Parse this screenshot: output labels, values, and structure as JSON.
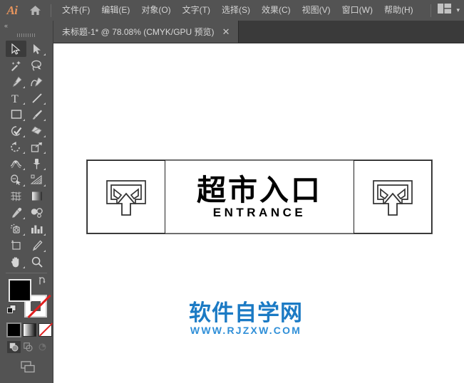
{
  "app": {
    "name": "Ai",
    "logo_color": "#e8955d"
  },
  "menubar": {
    "home_icon": "home-icon",
    "items": [
      {
        "label": "文件(F)",
        "name": "menu-file"
      },
      {
        "label": "编辑(E)",
        "name": "menu-edit"
      },
      {
        "label": "对象(O)",
        "name": "menu-object"
      },
      {
        "label": "文字(T)",
        "name": "menu-type"
      },
      {
        "label": "选择(S)",
        "name": "menu-select"
      },
      {
        "label": "效果(C)",
        "name": "menu-effect"
      },
      {
        "label": "视图(V)",
        "name": "menu-view"
      },
      {
        "label": "窗口(W)",
        "name": "menu-window"
      },
      {
        "label": "帮助(H)",
        "name": "menu-help"
      }
    ],
    "workspace_icon": "workspace-switcher-icon",
    "workspace_chevron": "▾"
  },
  "tabbar": {
    "document_title": "未标题-1* @ 78.08% (CMYK/GPU 预览)",
    "close_label": "✕"
  },
  "toolbar": {
    "collapse_label": "«",
    "tools": [
      {
        "name": "selection-tool",
        "label": "选择工具",
        "active": true,
        "corner": false
      },
      {
        "name": "direct-selection-tool",
        "label": "直接选择工具",
        "active": false,
        "corner": true
      },
      {
        "name": "magic-wand-tool",
        "label": "魔棒工具",
        "active": false,
        "corner": false
      },
      {
        "name": "lasso-tool",
        "label": "套索工具",
        "active": false,
        "corner": false
      },
      {
        "name": "pen-tool",
        "label": "钢笔工具",
        "active": false,
        "corner": true
      },
      {
        "name": "curvature-tool",
        "label": "曲率工具",
        "active": false,
        "corner": false
      },
      {
        "name": "type-tool",
        "label": "文字工具",
        "active": false,
        "corner": true
      },
      {
        "name": "line-segment-tool",
        "label": "直线段工具",
        "active": false,
        "corner": true
      },
      {
        "name": "rectangle-tool",
        "label": "矩形工具",
        "active": false,
        "corner": true
      },
      {
        "name": "paintbrush-tool",
        "label": "画笔工具",
        "active": false,
        "corner": true
      },
      {
        "name": "shaper-tool",
        "label": "Shaper 工具",
        "active": false,
        "corner": true
      },
      {
        "name": "eraser-tool",
        "label": "橡皮擦工具",
        "active": false,
        "corner": true
      },
      {
        "name": "rotate-tool",
        "label": "旋转工具",
        "active": false,
        "corner": true
      },
      {
        "name": "scale-tool",
        "label": "比例缩放工具",
        "active": false,
        "corner": true
      },
      {
        "name": "width-tool",
        "label": "宽度工具",
        "active": false,
        "corner": true
      },
      {
        "name": "free-transform-tool",
        "label": "自由变换工具",
        "active": false,
        "corner": true
      },
      {
        "name": "shape-builder-tool",
        "label": "形状生成器工具",
        "active": false,
        "corner": true
      },
      {
        "name": "perspective-grid-tool",
        "label": "透视网格工具",
        "active": false,
        "corner": true
      },
      {
        "name": "mesh-tool",
        "label": "网格工具",
        "active": false,
        "corner": false
      },
      {
        "name": "gradient-tool",
        "label": "渐变工具",
        "active": false,
        "corner": false
      },
      {
        "name": "eyedropper-tool",
        "label": "吸管工具",
        "active": false,
        "corner": true
      },
      {
        "name": "blend-tool",
        "label": "混合工具",
        "active": false,
        "corner": false
      },
      {
        "name": "symbol-sprayer-tool",
        "label": "符号喷枪工具",
        "active": false,
        "corner": true
      },
      {
        "name": "column-graph-tool",
        "label": "柱形图工具",
        "active": false,
        "corner": true
      },
      {
        "name": "artboard-tool",
        "label": "画板工具",
        "active": false,
        "corner": false
      },
      {
        "name": "slice-tool",
        "label": "切片工具",
        "active": false,
        "corner": true
      },
      {
        "name": "hand-tool",
        "label": "抓手工具",
        "active": false,
        "corner": true
      },
      {
        "name": "zoom-tool",
        "label": "缩放工具",
        "active": false,
        "corner": false
      }
    ],
    "fill_color": "#000000",
    "stroke_color": "none",
    "color_modes": [
      {
        "name": "color-mode-button",
        "label": "颜色",
        "selected": true
      },
      {
        "name": "gradient-mode-button",
        "label": "渐变",
        "selected": false
      },
      {
        "name": "none-mode-button",
        "label": "无",
        "selected": false
      }
    ],
    "draw_modes": [
      {
        "name": "draw-normal-button",
        "label": "正常绘图",
        "selected": true
      },
      {
        "name": "draw-behind-button",
        "label": "背面绘图",
        "selected": false
      },
      {
        "name": "draw-inside-button",
        "label": "内部绘图",
        "selected": false
      }
    ],
    "screen_mode": {
      "name": "change-screen-mode-button",
      "label": "更改屏幕模式"
    }
  },
  "artwork": {
    "sign_text_cn": "超市入口",
    "sign_text_en": "ENTRANCE",
    "icon_name": "entrance-arrow-icon",
    "panels": [
      "left-icon-panel",
      "center-text-panel",
      "right-icon-panel"
    ]
  },
  "watermark": {
    "title": "软件自学网",
    "url": "WWW.RJZXW.COM",
    "color": "#1b7ac4"
  }
}
